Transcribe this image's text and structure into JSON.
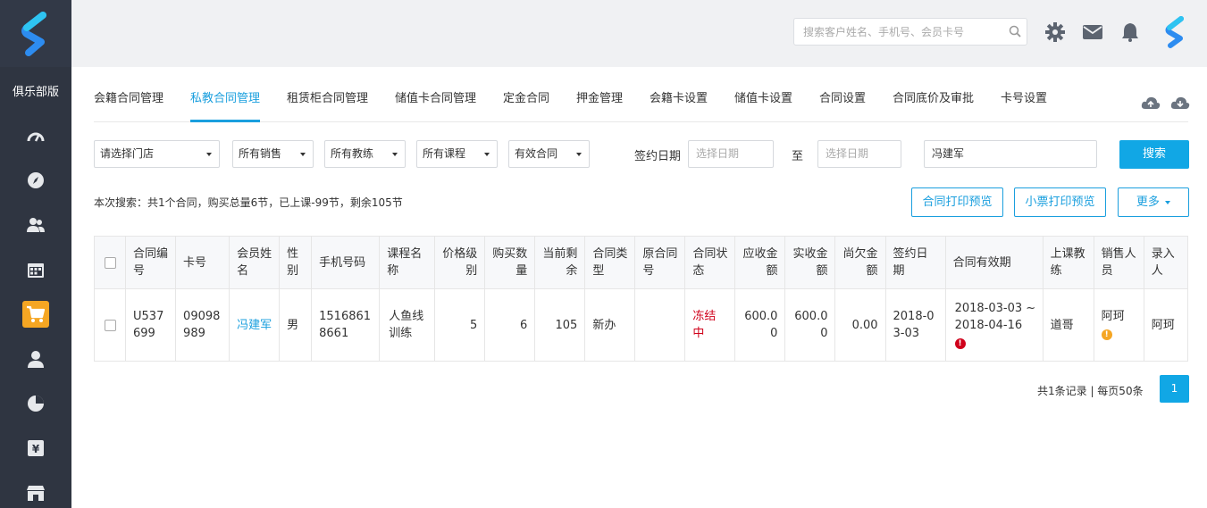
{
  "sidebar": {
    "club_label": "俱乐部版",
    "items": [
      {
        "icon": "dashboard-icon"
      },
      {
        "icon": "compass-icon"
      },
      {
        "icon": "users-icon"
      },
      {
        "icon": "calendar-icon"
      },
      {
        "icon": "cart-icon",
        "active": true
      },
      {
        "icon": "user-icon"
      },
      {
        "icon": "pie-chart-icon"
      },
      {
        "icon": "yen-icon"
      },
      {
        "icon": "store-icon"
      }
    ]
  },
  "header": {
    "search_placeholder": "搜索客户姓名、手机号、会员卡号"
  },
  "tabs": [
    {
      "label": "会籍合同管理"
    },
    {
      "label": "私教合同管理",
      "active": true
    },
    {
      "label": "租赁柜合同管理"
    },
    {
      "label": "储值卡合同管理"
    },
    {
      "label": "定金合同"
    },
    {
      "label": "押金管理"
    },
    {
      "label": "会籍卡设置"
    },
    {
      "label": "储值卡设置"
    },
    {
      "label": "合同设置"
    },
    {
      "label": "合同底价及审批"
    },
    {
      "label": "卡号设置"
    }
  ],
  "filters": {
    "store": "请选择门店",
    "sales": "所有销售",
    "coach": "所有教练",
    "course": "所有课程",
    "contract_status": "有效合同",
    "sign_date_label": "签约日期",
    "date_from_placeholder": "选择日期",
    "to_label": "至",
    "date_to_placeholder": "选择日期",
    "keyword": "冯建军",
    "search_button": "搜索"
  },
  "summary": "本次搜索：共1个合同，购买总量6节，已上课-99节，剩余105节",
  "actions": {
    "print_contract": "合同打印预览",
    "print_receipt": "小票打印预览",
    "more": "更多"
  },
  "table": {
    "headers": [
      "合同编号",
      "卡号",
      "会员姓名",
      "性别",
      "手机号码",
      "课程名称",
      "价格级别",
      "购买数量",
      "当前剩余",
      "合同类型",
      "原合同号",
      "合同状态",
      "应收金额",
      "实收金额",
      "尚欠金额",
      "签约日期",
      "合同有效期",
      "上课教练",
      "销售人员",
      "录入人"
    ],
    "rows": [
      {
        "contract_no": "U537699",
        "card_no": "09098989",
        "member_name": "冯建军",
        "gender": "男",
        "phone": "15168618661",
        "course": "人鱼线训练",
        "price_level": "5",
        "purchase_qty": "6",
        "remaining": "105",
        "contract_type": "新办",
        "original_contract": "",
        "status": "冻结中",
        "receivable": "600.00",
        "received": "600.00",
        "owed": "0.00",
        "sign_date": "2018-03-03",
        "validity": "2018-03-03 ~ 2018-04-16",
        "coach": "道哥",
        "sales": "阿珂",
        "entered_by": "阿珂"
      }
    ]
  },
  "pagination": {
    "info": "共1条记录 | 每页50条",
    "current_page": "1"
  },
  "colors": {
    "accent": "#11a7e5",
    "sidebar_bg": "#2f3541",
    "active_icon_bg": "#f5a623",
    "status_red": "#d0021b",
    "warning_orange": "#f5a623"
  }
}
